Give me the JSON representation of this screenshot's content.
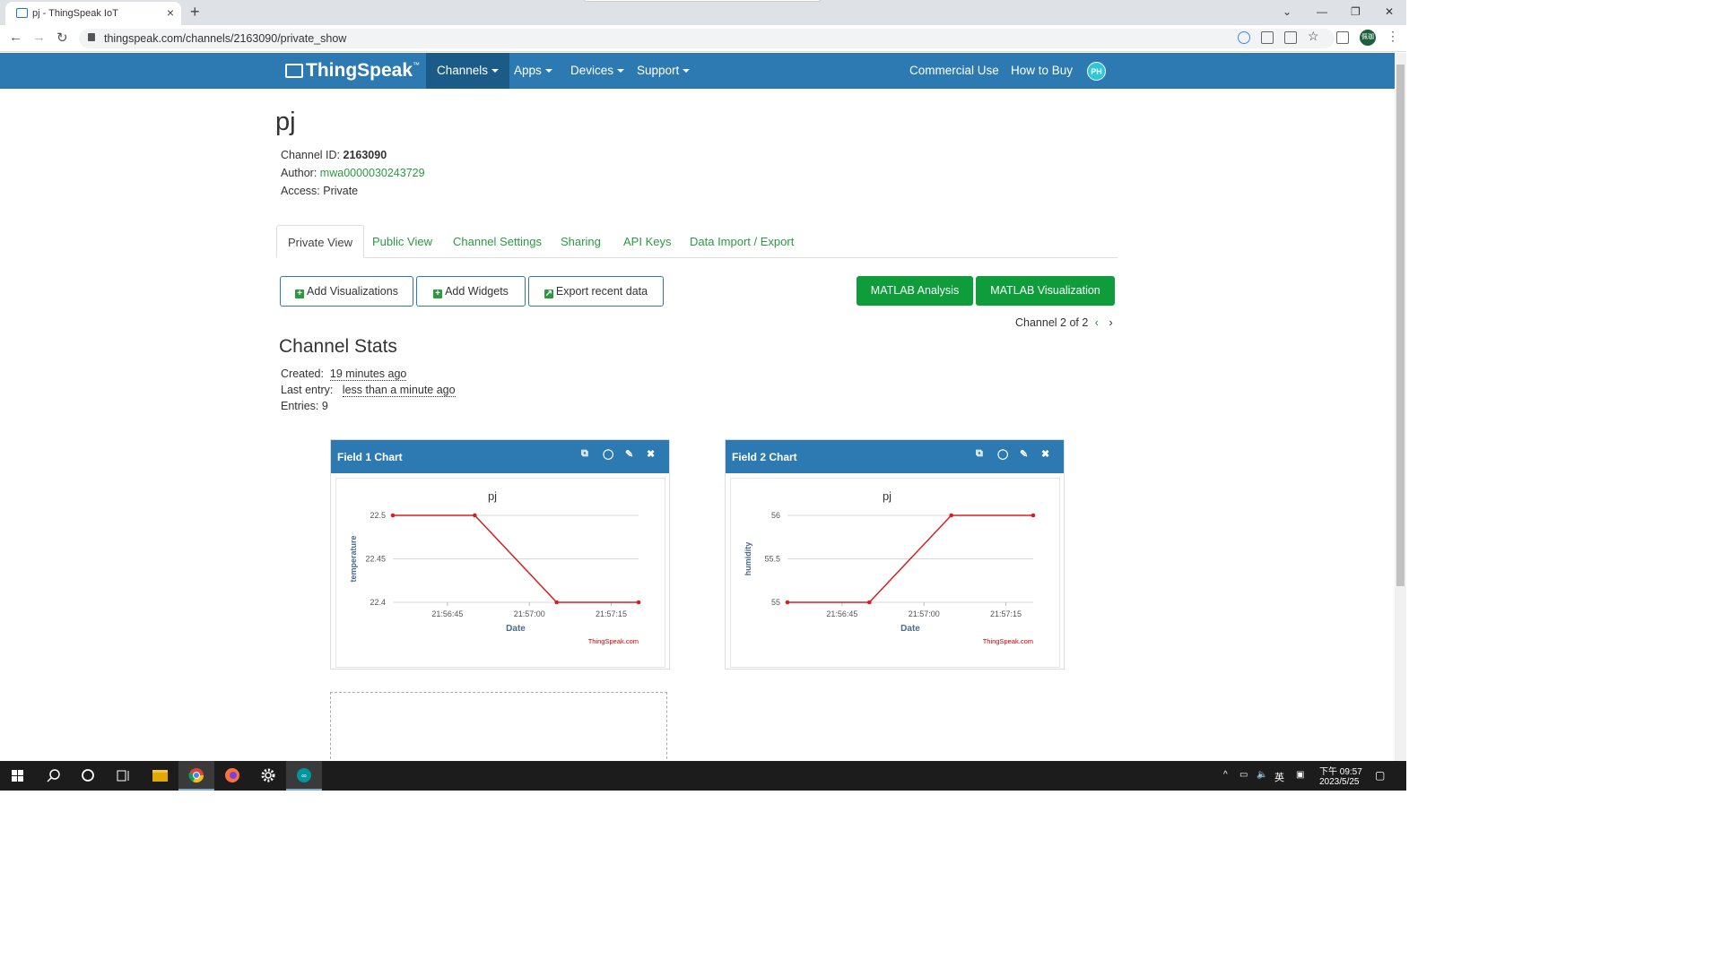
{
  "browser": {
    "tab_title": "pj - ThingSpeak IoT",
    "new_tab": "+",
    "url": "thingspeak.com/channels/2163090/private_show",
    "profile_label": "佩珈"
  },
  "header": {
    "logo": "ThingSpeak",
    "logo_tm": "™",
    "nav": [
      "Channels",
      "Apps",
      "Devices",
      "Support"
    ],
    "right": [
      "Commercial Use",
      "How to Buy"
    ],
    "avatar": "PH"
  },
  "channel": {
    "title": "pj",
    "id_label": "Channel ID:",
    "id": "2163090",
    "author_label": "Author:",
    "author": "mwa0000030243729",
    "access": "Access: Private"
  },
  "tabs": [
    "Private View",
    "Public View",
    "Channel Settings",
    "Sharing",
    "API Keys",
    "Data Import / Export"
  ],
  "buttons": {
    "add_vis": "Add Visualizations",
    "add_widgets": "Add Widgets",
    "export": "Export recent data",
    "matlab_analysis": "MATLAB Analysis",
    "matlab_vis": "MATLAB Visualization"
  },
  "channel_nav": "Channel 2 of 2",
  "stats": {
    "heading": "Channel Stats",
    "created_label": "Created:",
    "created": "19 minutes ago",
    "last_label": "Last entry:",
    "last": "less than a minute ago",
    "entries": "Entries: 9"
  },
  "chart_data": [
    {
      "type": "line",
      "widget_title": "Field 1 Chart",
      "title": "pj",
      "xlabel": "Date",
      "ylabel": "temperature",
      "x": [
        "21:56:35",
        "21:56:50",
        "21:57:05",
        "21:57:20"
      ],
      "x_ticks": [
        "21:56:45",
        "21:57:00",
        "21:57:15"
      ],
      "y_ticks": [
        "22.5",
        "22.45",
        "22.4"
      ],
      "ylim": [
        22.4,
        22.5
      ],
      "values": [
        22.5,
        22.5,
        22.4,
        22.4
      ],
      "credit": "ThingSpeak.com",
      "color": "#d62020"
    },
    {
      "type": "line",
      "widget_title": "Field 2 Chart",
      "title": "pj",
      "xlabel": "Date",
      "ylabel": "humidity",
      "x": [
        "21:56:35",
        "21:56:50",
        "21:57:05",
        "21:57:20"
      ],
      "x_ticks": [
        "21:56:45",
        "21:57:00",
        "21:57:15"
      ],
      "y_ticks": [
        "56",
        "55.5",
        "55"
      ],
      "ylim": [
        55,
        56
      ],
      "values": [
        55,
        55,
        56,
        56
      ],
      "credit": "ThingSpeak.com",
      "color": "#d62020"
    }
  ],
  "taskbar": {
    "ime": "英",
    "time": "下午 09:57",
    "date": "2023/5/25"
  }
}
